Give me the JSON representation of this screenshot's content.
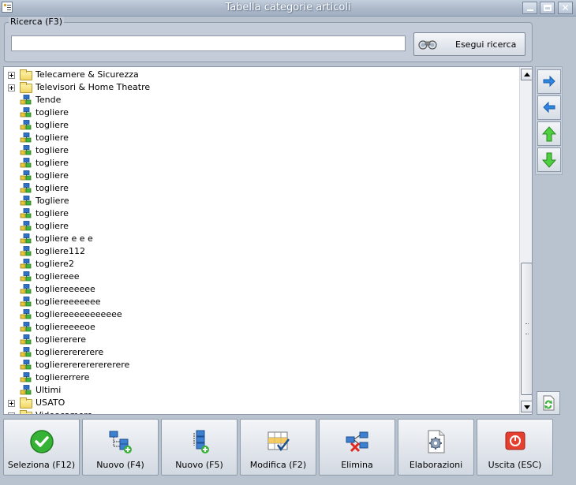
{
  "window": {
    "title": "Tabella categorie articoli",
    "controls": {
      "minimize": "minimize-button",
      "maximize": "maximize-button",
      "close": "close-button"
    }
  },
  "search": {
    "legend": "Ricerca (F3)",
    "value": "",
    "button_label": "Esegui ricerca"
  },
  "tree": {
    "items": [
      {
        "label": "Telecamere & Sicurezza",
        "kind": "folder",
        "expandable": true
      },
      {
        "label": "Televisori & Home Theatre",
        "kind": "folder",
        "expandable": true
      },
      {
        "label": "Tende",
        "kind": "category",
        "expandable": false
      },
      {
        "label": "togliere",
        "kind": "category",
        "expandable": false
      },
      {
        "label": "togliere",
        "kind": "category",
        "expandable": false
      },
      {
        "label": "togliere",
        "kind": "category",
        "expandable": false
      },
      {
        "label": "togliere",
        "kind": "category",
        "expandable": false
      },
      {
        "label": "togliere",
        "kind": "category",
        "expandable": false
      },
      {
        "label": "togliere",
        "kind": "category",
        "expandable": false
      },
      {
        "label": "togliere",
        "kind": "category",
        "expandable": false
      },
      {
        "label": "Togliere",
        "kind": "category",
        "expandable": false
      },
      {
        "label": "togliere",
        "kind": "category",
        "expandable": false
      },
      {
        "label": "togliere",
        "kind": "category",
        "expandable": false
      },
      {
        "label": "togliere e e e",
        "kind": "category",
        "expandable": false
      },
      {
        "label": "togliere112",
        "kind": "category",
        "expandable": false
      },
      {
        "label": "togliere2",
        "kind": "category",
        "expandable": false
      },
      {
        "label": "togliereee",
        "kind": "category",
        "expandable": false
      },
      {
        "label": "togliereeeeee",
        "kind": "category",
        "expandable": false
      },
      {
        "label": "togliereeeeeee",
        "kind": "category",
        "expandable": false
      },
      {
        "label": "togliereeeeeeeeeee",
        "kind": "category",
        "expandable": false
      },
      {
        "label": "togliereeeeoe",
        "kind": "category",
        "expandable": false
      },
      {
        "label": "togliererere",
        "kind": "category",
        "expandable": false
      },
      {
        "label": "togliererererere",
        "kind": "category",
        "expandable": false
      },
      {
        "label": "toglierererererererere",
        "kind": "category",
        "expandable": false
      },
      {
        "label": "togliererrere",
        "kind": "category",
        "expandable": false
      },
      {
        "label": "Ultimi",
        "kind": "category",
        "expandable": false
      },
      {
        "label": "USATO",
        "kind": "folder",
        "expandable": true
      },
      {
        "label": "Videocamere",
        "kind": "folder",
        "expandable": true
      }
    ]
  },
  "side_nav": [
    {
      "name": "move-right-button",
      "icon": "arrow-right-icon"
    },
    {
      "name": "move-left-button",
      "icon": "arrow-left-icon"
    },
    {
      "name": "move-up-button",
      "icon": "arrow-up-icon"
    },
    {
      "name": "move-down-button",
      "icon": "arrow-down-icon"
    }
  ],
  "toolbar": {
    "buttons": [
      {
        "name": "seleziona-button",
        "label": "Seleziona (F12)",
        "icon": "check-icon"
      },
      {
        "name": "nuovo-f4-button",
        "label": "Nuovo (F4)",
        "icon": "new-child-node-icon"
      },
      {
        "name": "nuovo-f5-button",
        "label": "Nuovo (F5)",
        "icon": "new-sibling-node-icon"
      },
      {
        "name": "modifica-button",
        "label": "Modifica (F2)",
        "icon": "edit-grid-icon"
      },
      {
        "name": "elimina-button",
        "label": "Elimina",
        "icon": "delete-node-icon"
      },
      {
        "name": "elaborazioni-button",
        "label": "Elaborazioni",
        "icon": "process-document-icon"
      },
      {
        "name": "uscita-button",
        "label": "Uscita (ESC)",
        "icon": "exit-icon"
      }
    ]
  },
  "colors": {
    "accent": "#1e73c8",
    "check": "#2fae2f",
    "exit": "#e23b2e"
  }
}
